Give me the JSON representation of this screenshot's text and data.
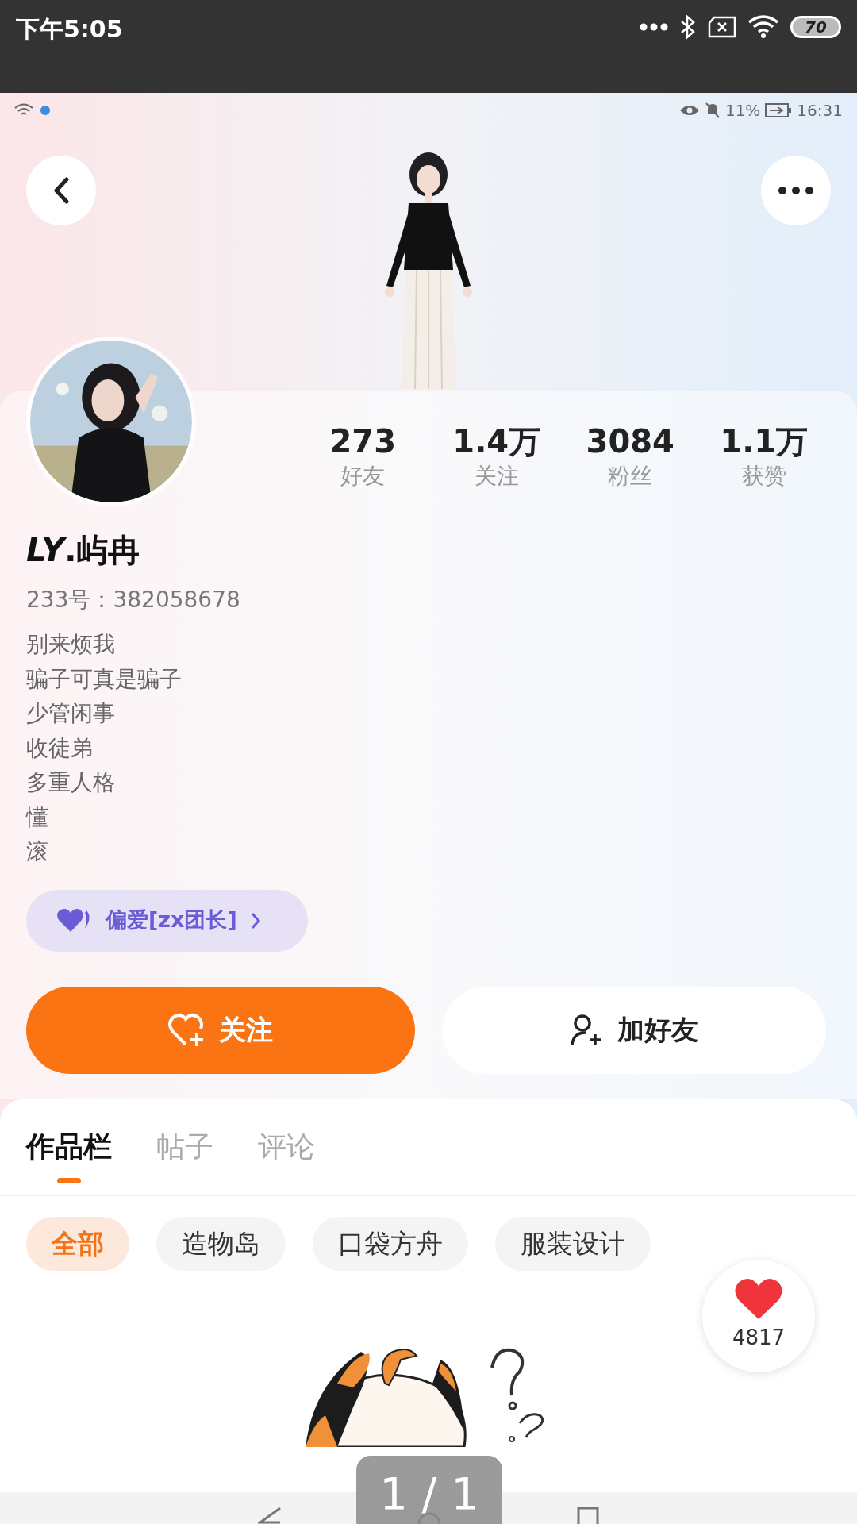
{
  "outer_status_bar": {
    "time": "下午5:05",
    "battery": "70"
  },
  "inner_status_bar": {
    "battery_percent": "11%",
    "time": "16:31"
  },
  "profile": {
    "stats": [
      {
        "value": "273",
        "label": "好友"
      },
      {
        "value": "1.4万",
        "label": "关注"
      },
      {
        "value": "3084",
        "label": "粉丝"
      },
      {
        "value": "1.1万",
        "label": "获赞"
      }
    ],
    "name": "*LY*.屿冉",
    "id": "233号：382058678",
    "bio": [
      "别来烦我",
      "骗子可真是骗子",
      "少管闲事",
      "收徒弟",
      "多重人格",
      "懂",
      "滚"
    ],
    "badge": "偏爱[zx团长]"
  },
  "actions": [
    {
      "kind": "follow",
      "label": "关注"
    },
    {
      "kind": "add_friend",
      "label": "加好友"
    }
  ],
  "tabs": [
    {
      "label": "作品栏",
      "selected": true
    },
    {
      "label": "帖子",
      "selected": false
    },
    {
      "label": "评论",
      "selected": false
    }
  ],
  "filters": [
    {
      "label": "全部",
      "selected": true
    },
    {
      "label": "造物岛",
      "selected": false
    },
    {
      "label": "口袋方舟",
      "selected": false
    },
    {
      "label": "服装设计",
      "selected": false
    }
  ],
  "like_count": "4817",
  "viewer": {
    "page_indicator": "1 / 1"
  }
}
